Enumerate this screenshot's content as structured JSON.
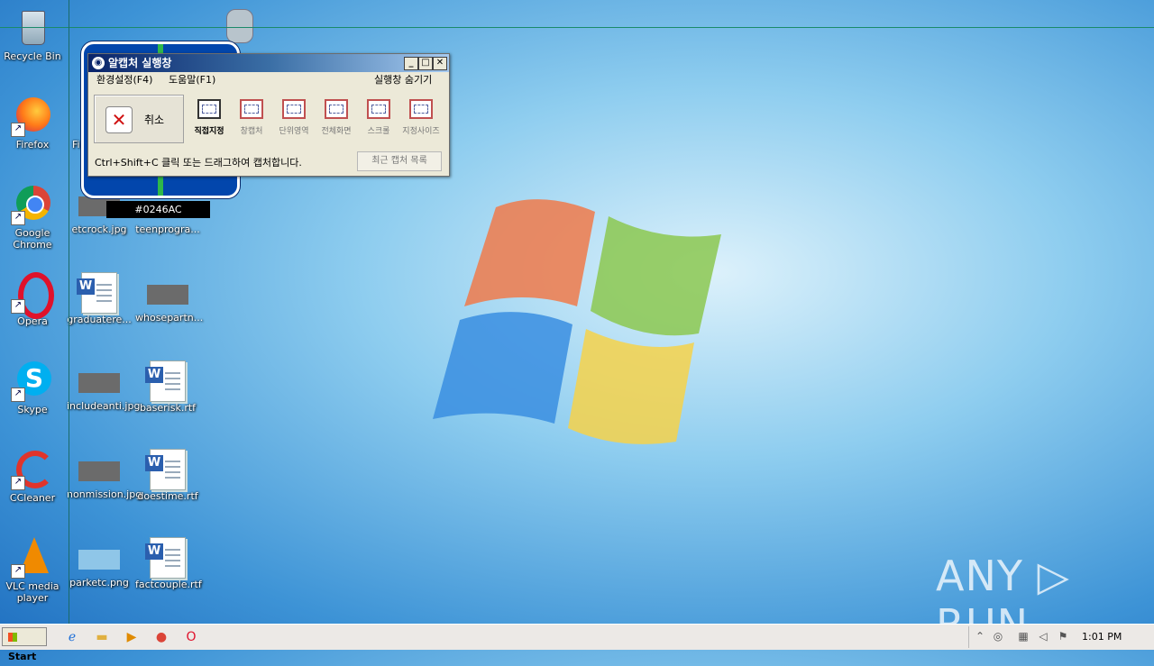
{
  "desktop": {
    "icons_col1": [
      {
        "label": "Recycle Bin",
        "icon": "recycle-bin-icon"
      },
      {
        "label": "Firefox",
        "icon": "firefox-icon"
      },
      {
        "label": "Google Chrome",
        "icon": "chrome-icon"
      },
      {
        "label": "Opera",
        "icon": "opera-icon"
      },
      {
        "label": "Skype",
        "icon": "skype-icon"
      },
      {
        "label": "CCleaner",
        "icon": "ccleaner-icon"
      },
      {
        "label": "VLC media player",
        "icon": "vlc-icon"
      }
    ],
    "icons_col2": [
      {
        "label": "Fi",
        "icon": "shortcut-icon"
      },
      {
        "label": "etcrock.jpg",
        "icon": "image-file-icon"
      },
      {
        "label": "graduatere...",
        "icon": "word-doc-icon"
      },
      {
        "label": "includeanti.jpg",
        "icon": "image-file-icon"
      },
      {
        "label": "nonmission.jpg",
        "icon": "image-file-icon"
      },
      {
        "label": "parketc.png",
        "icon": "image-file-icon"
      }
    ],
    "icons_col3": [
      {
        "label": "teenprogra...",
        "icon": "image-file-icon"
      },
      {
        "label": "whosepartn...",
        "icon": "image-file-icon"
      },
      {
        "label": "baserisk.rtf",
        "icon": "word-doc-icon"
      },
      {
        "label": "doestime.rtf",
        "icon": "word-doc-icon"
      },
      {
        "label": "factcouple.rtf",
        "icon": "word-doc-icon"
      }
    ]
  },
  "magnifier": {
    "color_code": "#0246AC",
    "sampled_color": "#0246AC"
  },
  "capture_window": {
    "title": "알캡처 실행창",
    "menu": {
      "settings": "환경설정(F4)",
      "help": "도움말(F1)",
      "hide": "실행창 숨기기"
    },
    "cancel_label": "취소",
    "tools": [
      {
        "label": "직접지정",
        "active": true
      },
      {
        "label": "창캡처",
        "active": false
      },
      {
        "label": "단위영역",
        "active": false
      },
      {
        "label": "전체화면",
        "active": false
      },
      {
        "label": "스크롤",
        "active": false
      },
      {
        "label": "지정사이즈",
        "active": false
      }
    ],
    "hint": "Ctrl+Shift+C 클릭 또는 드래그하여 캡처합니다.",
    "recent_label": "최근 캡처 목록",
    "controls": {
      "minimize": "_",
      "maximize": "□",
      "close": "✕"
    }
  },
  "taskbar": {
    "start_label": "Start",
    "apps": [
      "ie-icon",
      "explorer-icon",
      "media-player-icon",
      "chrome-icon",
      "opera-icon"
    ],
    "clock": "1:01 PM"
  },
  "watermark": "ANY ▷ RUN",
  "colors": {
    "accent": "#0246AC",
    "crosshair": "#1a8a6a"
  }
}
